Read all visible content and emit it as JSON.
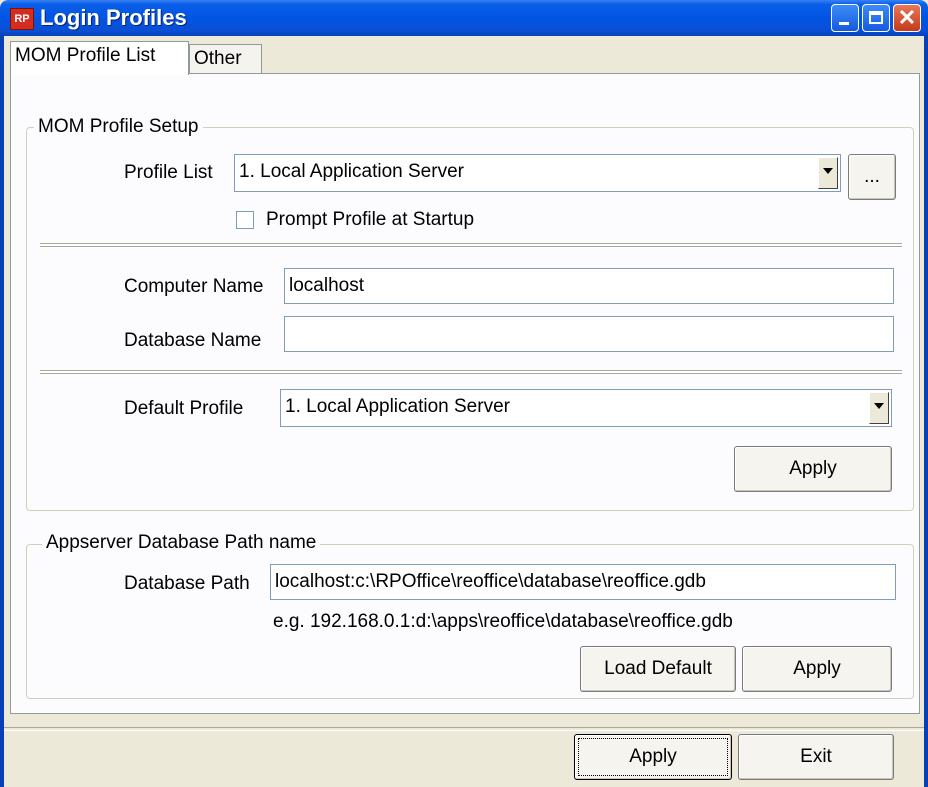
{
  "window": {
    "title": "Login Profiles",
    "app_icon_text": "RP"
  },
  "title_buttons": {
    "close_glyph": "✕"
  },
  "tabs": [
    {
      "label": "MOM Profile List",
      "active": true
    },
    {
      "label": "Other",
      "active": false
    }
  ],
  "profile_setup": {
    "legend": "MOM Profile Setup",
    "profile_list_label": "Profile List",
    "profile_list_value": "1. Local Application Server",
    "browse_button": "...",
    "prompt_checkbox_label": "Prompt Profile at Startup",
    "prompt_checked": false,
    "computer_name_label": "Computer Name",
    "computer_name_value": "localhost",
    "database_name_label": "Database Name",
    "database_name_value": "",
    "default_profile_label": "Default Profile",
    "default_profile_value": "1. Local Application Server",
    "apply_button": "Apply"
  },
  "appserver": {
    "legend": "Appserver Database Path name",
    "database_path_label": "Database Path",
    "database_path_value": "localhost:c:\\RPOffice\\reoffice\\database\\reoffice.gdb",
    "example_text": "e.g. 192.168.0.1:d:\\apps\\reoffice\\database\\reoffice.gdb",
    "load_default_button": "Load Default",
    "apply_button": "Apply"
  },
  "footer": {
    "apply_button": "Apply",
    "exit_button": "Exit"
  }
}
